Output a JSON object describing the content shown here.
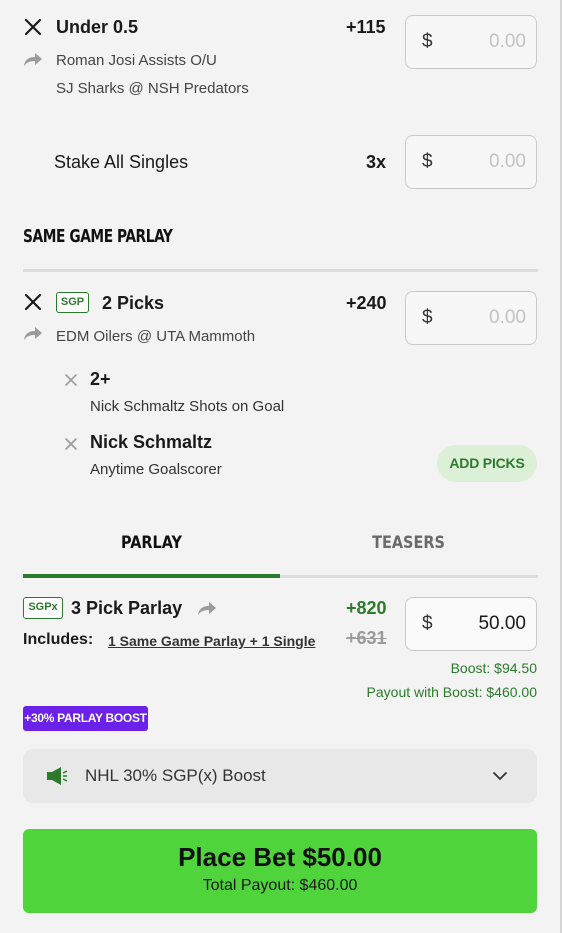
{
  "single": {
    "title": "Under 0.5",
    "odds": "+115",
    "market": "Roman Josi Assists O/U",
    "game": "SJ Sharks @ NSH Predators",
    "stake_currency": "$",
    "stake_placeholder": "0.00"
  },
  "stake_all": {
    "label": "Stake All Singles",
    "multiplier": "3x",
    "currency": "$",
    "placeholder": "0.00"
  },
  "sgp_section": {
    "title": "SAME GAME PARLAY",
    "badge": "SGP",
    "picks_label": "2 Picks",
    "odds": "+240",
    "game": "EDM Oilers @ UTA Mammoth",
    "currency": "$",
    "placeholder": "0.00",
    "legs": [
      {
        "title": "2+",
        "market": "Nick Schmaltz Shots on Goal"
      },
      {
        "title": "Nick Schmaltz",
        "market": "Anytime Goalscorer"
      }
    ],
    "add_picks": "ADD PICKS"
  },
  "tabs": [
    {
      "label": "PARLAY",
      "active": true
    },
    {
      "label": "TEASERS",
      "active": false
    }
  ],
  "parlay": {
    "badge": "SGPx",
    "title": "3 Pick Parlay",
    "includes_label": "Includes:",
    "includes_value": "1 Same Game Parlay + 1 Single",
    "odds_boosted": "+820",
    "odds_original": "+631",
    "currency": "$",
    "stake": "50.00",
    "boost_line": "Boost: $94.50",
    "payout_line": "Payout with Boost: $460.00",
    "boost_badge": "+30% PARLAY BOOST"
  },
  "boost_select": {
    "label": "NHL 30% SGP(x) Boost",
    "icon": "megaphone-icon"
  },
  "place_bet": {
    "label": "Place Bet $50.00",
    "payout": "Total Payout: $460.00"
  },
  "colors": {
    "accent_green": "#2c7a2c",
    "cta_green": "#4fd43c",
    "boost_purple": "#6b21e8"
  }
}
